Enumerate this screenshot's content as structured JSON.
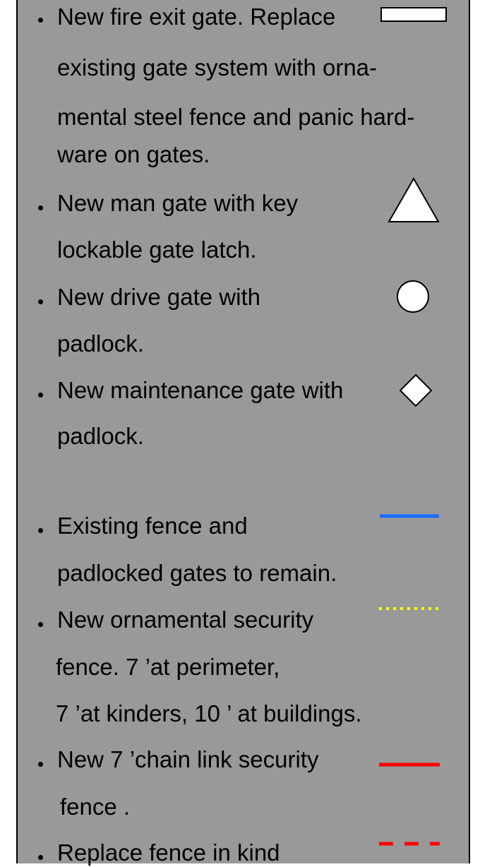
{
  "legend": {
    "items": [
      {
        "id": "fire-exit-gate",
        "lines": [
          "New fire exit gate. Replace",
          "existing gate system with orna-",
          "mental steel fence and panic hard-",
          "ware on gates."
        ],
        "symbol": "white-rectangle-icon"
      },
      {
        "id": "man-gate",
        "lines": [
          "New man gate with key",
          "lockable gate latch."
        ],
        "symbol": "white-triangle-icon"
      },
      {
        "id": "drive-gate",
        "lines": [
          "New drive gate with",
          "padlock."
        ],
        "symbol": "white-circle-icon"
      },
      {
        "id": "maintenance-gate",
        "lines": [
          "New maintenance gate with",
          "padlock."
        ],
        "symbol": "white-diamond-icon"
      },
      {
        "id": "existing-fence",
        "lines": [
          "Existing fence and",
          "padlocked gates to remain."
        ],
        "symbol": "blue-solid-line-icon"
      },
      {
        "id": "ornamental-fence",
        "lines": [
          "New ornamental security",
          "fence.  7 ’at perimeter,",
          "7 ’at kinders, 10 ’ at buildings."
        ],
        "symbol": "yellow-dotted-line-icon"
      },
      {
        "id": "chain-link-fence",
        "lines": [
          "New 7 ’chain link security",
          "fence ."
        ],
        "symbol": "red-solid-line-icon"
      },
      {
        "id": "replace-fence",
        "lines": [
          "Replace fence in kind"
        ],
        "symbol": "red-dashed-line-icon"
      }
    ]
  },
  "colors": {
    "panel_bg": "#999999",
    "blue_line": "#1a6cff",
    "yellow_line": "#ffff00",
    "red_line": "#ff0000",
    "symbol_fill": "#ffffff"
  }
}
